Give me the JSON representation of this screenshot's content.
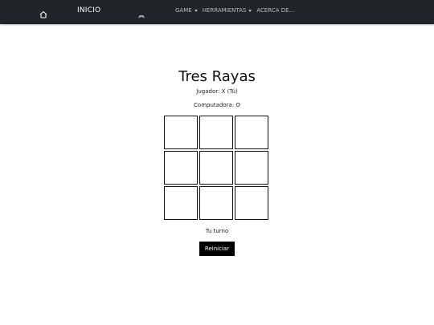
{
  "navbar": {
    "home_icon": "home-icon",
    "brand": "INICIO",
    "game_icon": "gamepad-icon",
    "menu": [
      {
        "label": "GAME",
        "dropdown": true
      },
      {
        "label": "HERRAMIENTAS",
        "dropdown": true
      },
      {
        "label": "ACERCA DE...",
        "dropdown": false
      }
    ]
  },
  "game": {
    "title": "Tres Rayas",
    "player_label": "Jugador: X (Tú)",
    "computer_label": "Computadora: O",
    "board": [
      "",
      "",
      "",
      "",
      "",
      "",
      "",
      "",
      ""
    ],
    "status": "Tu turno",
    "reset_label": "Reiniciar"
  },
  "colors": {
    "navbar_bg": "#212529",
    "button_bg": "#000000"
  }
}
